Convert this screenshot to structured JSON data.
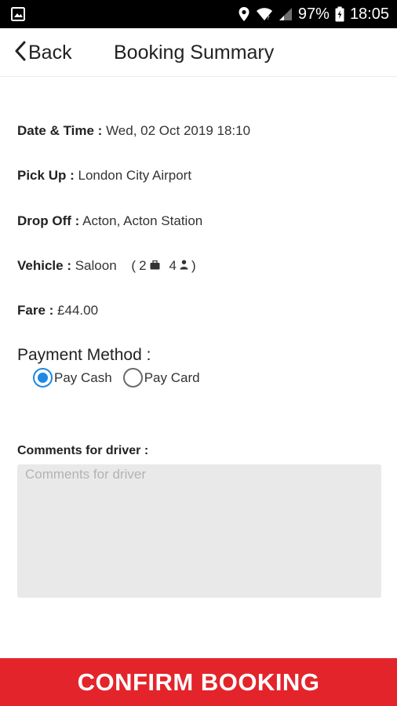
{
  "status_bar": {
    "battery": "97%",
    "time": "18:05",
    "icons": [
      "image-icon",
      "location-icon",
      "wifi-icon",
      "signal-icon",
      "battery-icon"
    ]
  },
  "header": {
    "back_label": "Back",
    "title": "Booking Summary"
  },
  "details": {
    "date_time": {
      "label": "Date & Time :",
      "value": "Wed, 02 Oct 2019 18:10"
    },
    "pick_up": {
      "label": "Pick Up :",
      "value": "London City Airport"
    },
    "drop_off": {
      "label": "Drop Off :",
      "value": "Acton, Acton Station"
    },
    "vehicle": {
      "label": "Vehicle :",
      "value": "Saloon",
      "luggage": "2",
      "passengers": "4",
      "open": "(",
      "close": ")"
    },
    "fare": {
      "label": "Fare :",
      "value": "£44.00"
    }
  },
  "payment": {
    "title": "Payment Method :",
    "options": [
      {
        "label": "Pay Cash",
        "selected": true
      },
      {
        "label": "Pay Card",
        "selected": false
      }
    ]
  },
  "comments": {
    "label": "Comments for driver :",
    "placeholder": "Comments for driver",
    "value": ""
  },
  "confirm_label": "CONFIRM BOOKING",
  "colors": {
    "accent": "#e3242b",
    "radio_selected": "#1e88e5",
    "status_bar": "#000000"
  }
}
